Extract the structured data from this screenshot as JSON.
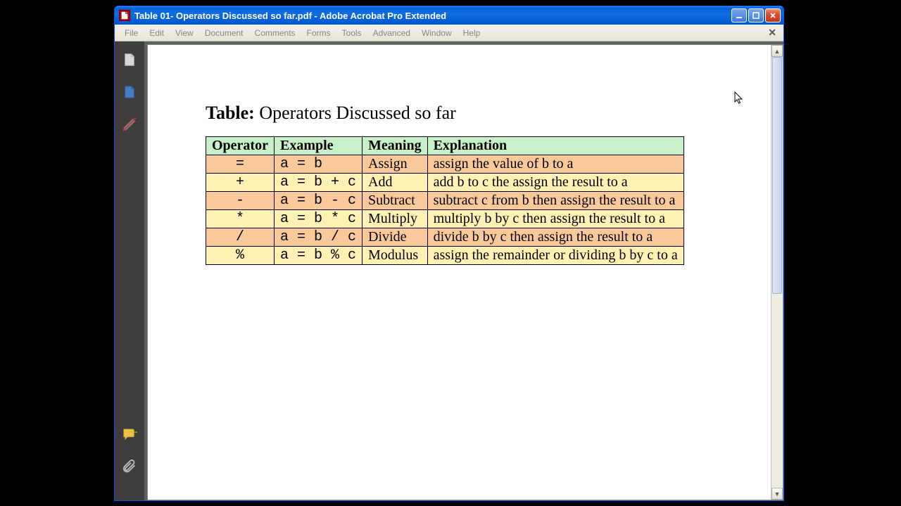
{
  "window": {
    "title": "Table 01- Operators Discussed so far.pdf - Adobe Acrobat Pro Extended"
  },
  "menu": {
    "items": [
      "File",
      "Edit",
      "View",
      "Document",
      "Comments",
      "Forms",
      "Tools",
      "Advanced",
      "Window",
      "Help"
    ]
  },
  "document": {
    "title_prefix": "Table:",
    "title_rest": " Operators Discussed so far",
    "columns": [
      "Operator",
      "Example",
      "Meaning",
      "Explanation"
    ],
    "rows": [
      {
        "operator": "=",
        "example": "a = b",
        "meaning": "Assign",
        "explanation": "assign the value of b to a"
      },
      {
        "operator": "+",
        "example": "a = b + c",
        "meaning": "Add",
        "explanation": "add b to c the assign the result to a"
      },
      {
        "operator": "-",
        "example": "a = b - c",
        "meaning": "Subtract",
        "explanation": "subtract c from b then assign the result to a"
      },
      {
        "operator": "*",
        "example": "a = b * c",
        "meaning": "Multiply",
        "explanation": "multiply b by c then assign the result to a"
      },
      {
        "operator": "/",
        "example": "a = b / c",
        "meaning": "Divide",
        "explanation": "divide b by c then assign the result to a"
      },
      {
        "operator": "%",
        "example": "a = b % c",
        "meaning": "Modulus",
        "explanation": "assign the remainder or dividing b by c to a"
      }
    ]
  }
}
